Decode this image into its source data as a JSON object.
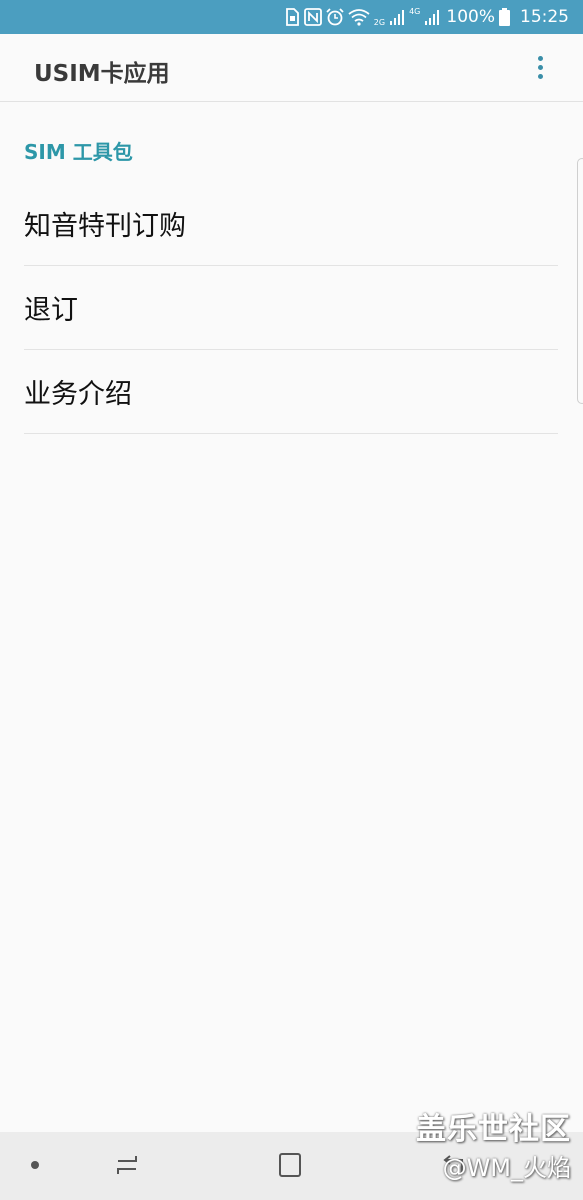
{
  "status_bar": {
    "battery_percent": "100%",
    "time": "15:25",
    "network_2g": "2G",
    "network_4g": "4G",
    "icons": [
      "sim-toolkit-icon",
      "nfc-icon",
      "alarm-icon",
      "wifi-icon",
      "signal-icon",
      "battery-icon"
    ]
  },
  "app_bar": {
    "title": "USIM卡应用",
    "overflow_icon": "more-vert-icon"
  },
  "section": {
    "header": "SIM 工具包"
  },
  "menu": {
    "items": [
      {
        "label": "知音特刊订购"
      },
      {
        "label": "退订"
      },
      {
        "label": "业务介绍"
      }
    ]
  },
  "nav_bar": {
    "icons": [
      "nav-dot-icon",
      "recent-apps-icon",
      "home-icon",
      "back-icon"
    ]
  },
  "watermark": {
    "site": "盖乐世社区",
    "user": "@WM_火焰"
  },
  "colors": {
    "status_bar": "#4b9ec0",
    "accent": "#2d97a8",
    "background": "#fafafa"
  }
}
